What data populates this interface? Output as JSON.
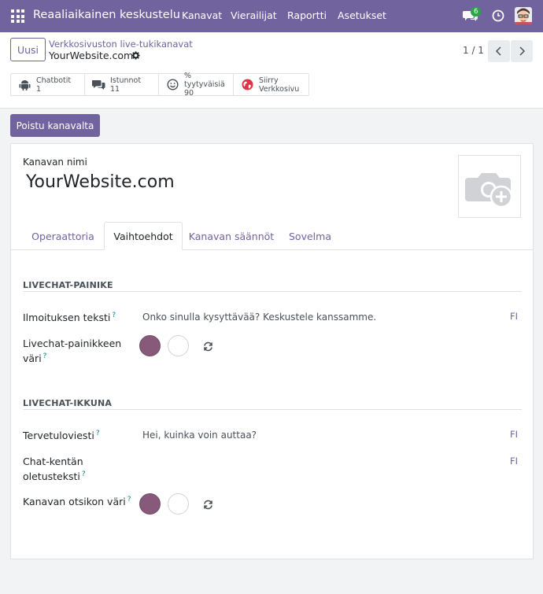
{
  "navbar": {
    "brand": "Reaaliaikainen keskustelu",
    "menu": [
      "Kanavat",
      "Vierailijat",
      "Raportti",
      "Asetukset"
    ],
    "chat_badge": "6",
    "accent_color": "#71639e"
  },
  "control_panel": {
    "new_button": "Uusi",
    "breadcrumb_parent": "Verkkosivuston live-tukikanavat",
    "breadcrumb_current": "YourWebsite.com",
    "pager": "1 / 1",
    "stats": [
      {
        "icon": "android-icon",
        "label": "Chatbotit",
        "value": "1"
      },
      {
        "icon": "comments-icon",
        "label": "Istunnot",
        "value": "11"
      },
      {
        "icon": "smile-icon",
        "label": "% tyytyväisiä",
        "value": "90"
      },
      {
        "icon": "globe-icon",
        "label": "Siirry",
        "value": "Verkkosivu"
      }
    ]
  },
  "actions": {
    "leave_channel": "Poistu kanavalta"
  },
  "form": {
    "name_label": "Kanavan nimi",
    "name_value": "YourWebsite.com",
    "tabs": [
      "Operaattoria",
      "Vaihtoehdot",
      "Kanavan säännöt",
      "Sovelma"
    ],
    "active_tab": "Vaihtoehdot",
    "button_section": {
      "title": "LIVECHAT-PAINIKE",
      "notification_label": "Ilmoituksen teksti",
      "notification_value": "Onko sinulla kysyttävää? Keskustele kanssamme.",
      "button_color_label_1": "Livechat-painikkeen",
      "button_color_label_2": "väri",
      "lang": "FI",
      "primary_color": "#875a7b"
    },
    "window_section": {
      "title": "LIVECHAT-IKKUNA",
      "welcome_label": "Tervetuloviesti",
      "welcome_value": "Hei, kuinka voin auttaa?",
      "placeholder_label_1": "Chat-kentän",
      "placeholder_label_2": "oletusteksti",
      "header_color_label": "Kanavan otsikon väri",
      "lang": "FI",
      "header_color": "#875a7b"
    },
    "help_marker": "?"
  }
}
